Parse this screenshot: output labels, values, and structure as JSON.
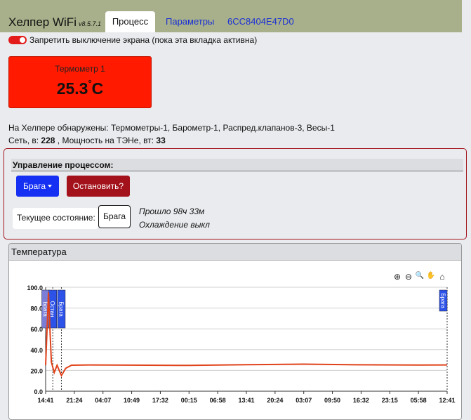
{
  "app": {
    "title": "Хелпер WiFi",
    "version": "v8.5.7.1"
  },
  "tabs": [
    {
      "label": "Процесс",
      "active": true
    },
    {
      "label": "Параметры",
      "active": false
    },
    {
      "label": "6CC8404E47D0",
      "active": false
    }
  ],
  "toggle": {
    "label": "Запретить выключение экрана (пока эта вкладка активна)",
    "on": true
  },
  "thermometer": {
    "name": "Термометр 1",
    "value": "25.3",
    "unit": "C",
    "degree": "°"
  },
  "info": {
    "detected": "На Хелпере обнаружены: Термометры-1, Барометр-1, Распред.клапанов-3, Весы-1",
    "net_label": "Сеть, в:",
    "net_value": "228",
    "power_label": ", Мощность на ТЭНе, вт:",
    "power_value": "33"
  },
  "process": {
    "header": "Управление процессом:",
    "mode_button": "Брага",
    "stop_button": "Остановить?",
    "state_label": "Текущее состояние:",
    "state_value": "Брага",
    "elapsed": "Прошло 98ч 33м",
    "cooling": "Охлаждение выкл"
  },
  "temperature_card": {
    "title": "Температура"
  },
  "toolbar": {
    "zoom_in": "⊕",
    "zoom_out": "⊖",
    "zoom_select": "🔍",
    "pan": "✋",
    "home": "⌂"
  },
  "colors": {
    "line": "#e0421a",
    "thermo_bg": "#ff1a00",
    "primary": "#1530f2",
    "danger": "#a3111b",
    "topbar": "#a7b08a"
  },
  "chart_data": {
    "type": "line",
    "ylim": [
      0,
      100
    ],
    "yticks": [
      "0.0",
      "20.0",
      "40.0",
      "60.0",
      "80.0",
      "100.0"
    ],
    "xticks": [
      "14:41",
      "21:24",
      "04:07",
      "10:49",
      "17:32",
      "00:15",
      "06:58",
      "13:41",
      "20:24",
      "03:07",
      "09:50",
      "16:32",
      "23:15",
      "05:58",
      "12:41"
    ],
    "series": [
      {
        "points": [
          [
            0.0,
            25
          ],
          [
            0.1,
            95
          ],
          [
            0.15,
            60
          ],
          [
            0.2,
            28
          ],
          [
            0.3,
            18
          ],
          [
            0.4,
            25
          ],
          [
            0.55,
            15
          ],
          [
            0.7,
            22
          ],
          [
            0.9,
            25
          ],
          [
            1.5,
            25.3
          ],
          [
            3,
            25.1
          ],
          [
            5,
            24.8
          ],
          [
            7,
            25.5
          ],
          [
            9,
            26
          ],
          [
            11,
            25.4
          ],
          [
            13,
            25.2
          ],
          [
            14,
            25.3
          ]
        ]
      }
    ],
    "markers": [
      {
        "x": 0.0,
        "label": "Брага"
      },
      {
        "x": 0.25,
        "label": "Остан"
      },
      {
        "x": 0.55,
        "label": "Брага"
      },
      {
        "x": 14.0,
        "label": "Брага"
      }
    ],
    "grid": true
  }
}
